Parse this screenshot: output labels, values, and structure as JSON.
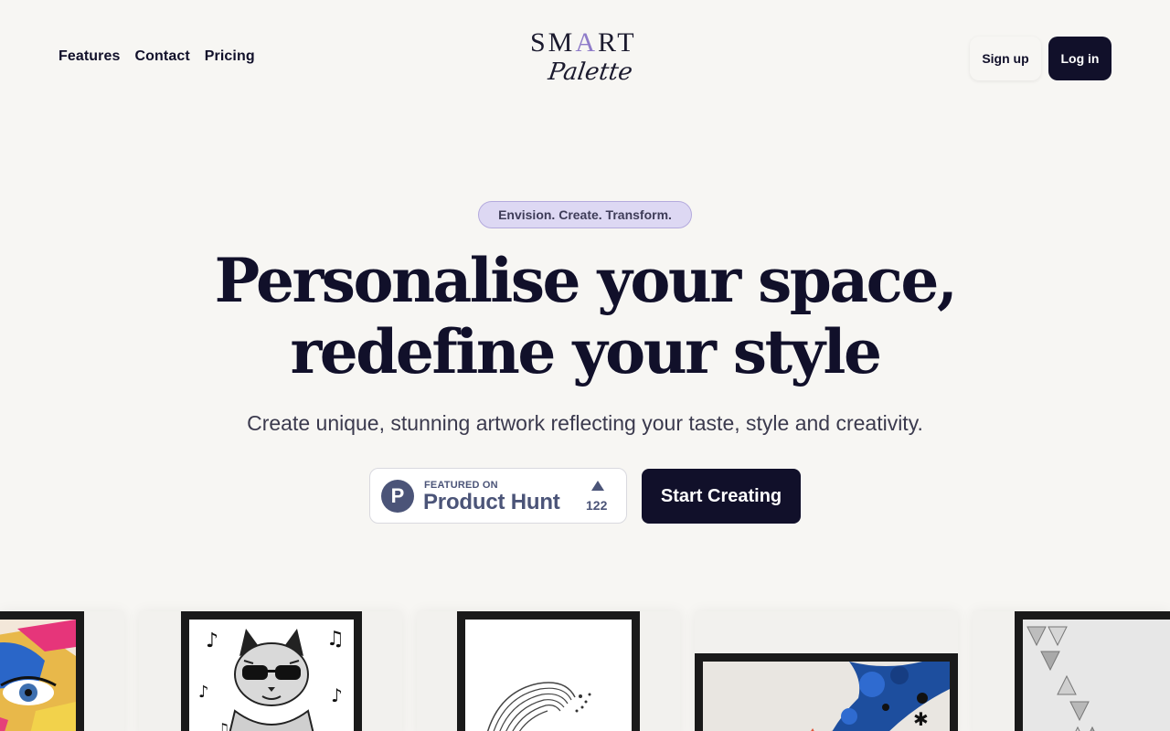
{
  "nav": {
    "links": [
      "Features",
      "Contact",
      "Pricing"
    ],
    "signup_label": "Sign up",
    "login_label": "Log in"
  },
  "logo": {
    "top_plain": "SM",
    "top_accent": "A",
    "top_rest": "RT",
    "bottom": "Palette"
  },
  "hero": {
    "badge": "Envision. Create. Transform.",
    "headline_line1": "Personalise your space,",
    "headline_line2": "redefine your style",
    "subheadline": "Create unique, stunning artwork reflecting your taste, style and creativity.",
    "cta_label": "Start Creating"
  },
  "product_hunt": {
    "featured_label": "FEATURED ON",
    "name": "Product Hunt",
    "logo_letter": "P",
    "upvotes": "122"
  },
  "colors": {
    "background": "#f7f6f3",
    "primary_dark": "#11102a",
    "accent_lavender": "#ddd8f3",
    "product_hunt": "#4b5478"
  },
  "gallery": {
    "items": [
      "colorful-eye-art",
      "cat-with-sunglasses-art",
      "wave-sketch-art",
      "blue-paint-splash-art",
      "geometric-triangles-art"
    ]
  }
}
